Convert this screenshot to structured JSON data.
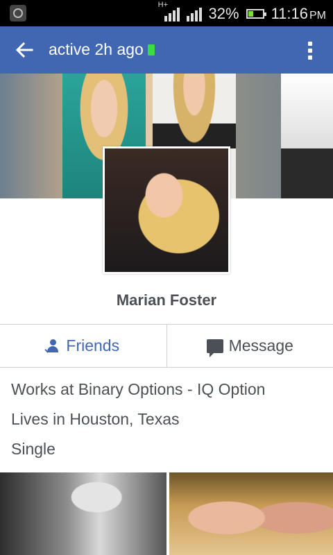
{
  "status_bar": {
    "network_type": "H+",
    "battery_percent": "32%",
    "battery_level": 0.32,
    "time": "11:16",
    "time_period": "PM"
  },
  "app_bar": {
    "title": "active 2h ago"
  },
  "profile": {
    "name": "Marian Foster"
  },
  "actions": {
    "friends_label": "Friends",
    "message_label": "Message"
  },
  "details": [
    "Works at Binary Options - IQ Option",
    "Lives in Houston, Texas",
    "Single"
  ],
  "icons": {
    "back": "arrow-left-icon",
    "more": "more-vertical-icon",
    "friends": "friend-check-icon",
    "message": "message-bubble-icon"
  },
  "colors": {
    "app_bar": "#4267b2",
    "friends_text": "#4267b2",
    "text": "#4b4f56",
    "online": "#3ddc3d"
  }
}
